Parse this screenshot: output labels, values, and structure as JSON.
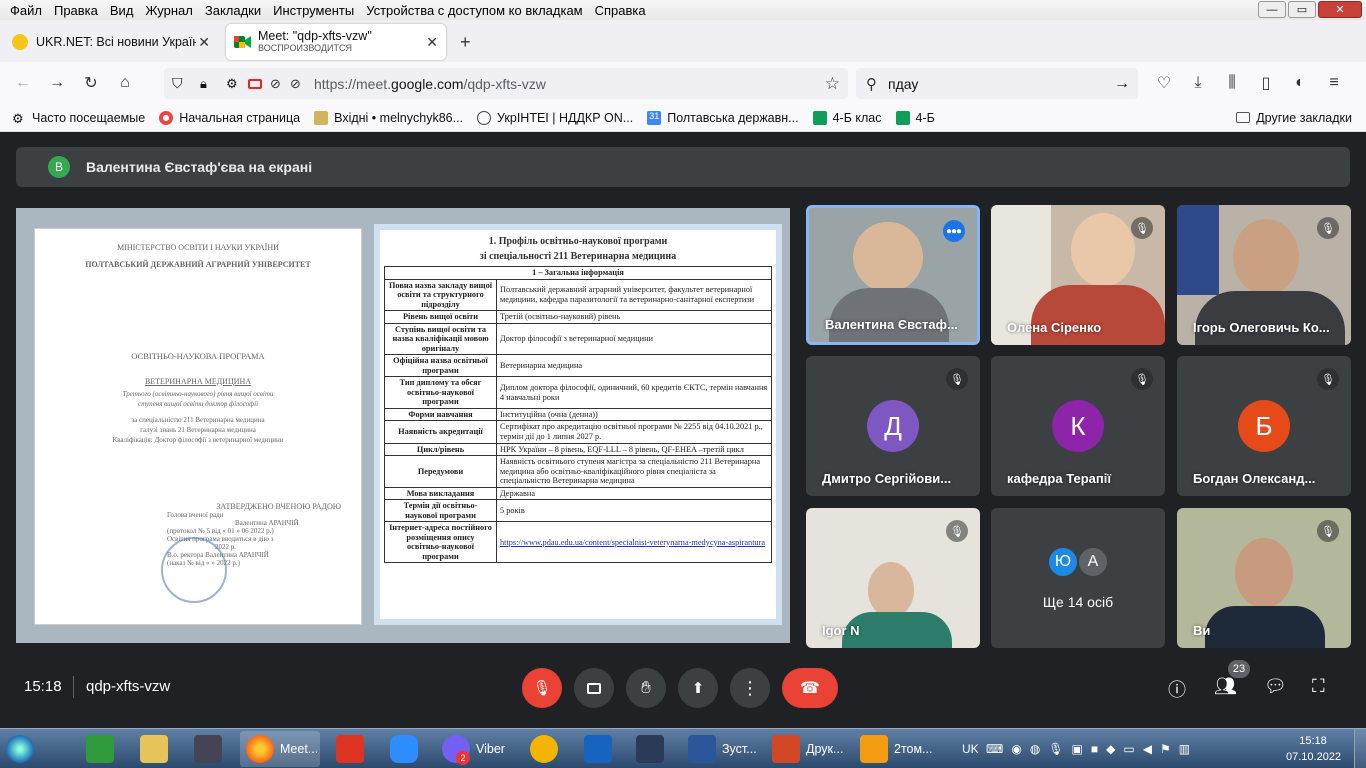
{
  "menu": [
    "Файл",
    "Правка",
    "Вид",
    "Журнал",
    "Закладки",
    "Инструменты",
    "Устройства с доступом ко вкладкам",
    "Справка"
  ],
  "tabs": [
    {
      "title": "UKR.NET: Всі новини України, ос"
    },
    {
      "title": "Meet: \"qdp-xfts-vzw\"",
      "subtitle": "ВОСПРОИЗВОДИТСЯ"
    }
  ],
  "nav": {
    "url_prefix": "https://meet.",
    "url_domain": "google.com",
    "url_path": "/qdp-xfts-vzw",
    "search_value": "пдау"
  },
  "bookmarks": [
    "Часто посещаемые",
    "Начальная страница",
    "Вхідні • melnychyk86...",
    "УкрІНТЕІ | НДДКР ON...",
    "Полтавська державн...",
    "4-Б клас",
    "4-Б"
  ],
  "other_bookmarks": "Другие закладки",
  "banner": {
    "avatar": "В",
    "text": "Валентина Євстаф'єва на екрані"
  },
  "cover": {
    "ministry": "МІНІСТЕРСТВО ОСВІТИ І НАУКИ УКРАЇНИ",
    "university": "ПОЛТАВСЬКИЙ ДЕРЖАВНИЙ АГРАРНИЙ УНІВЕРСИТЕТ",
    "program": "ОСВІТНЬО-НАУКОВА ПРОГРАМА",
    "name": "ВЕТЕРИНАРНА МЕДИЦИНА",
    "line1": "Третього (освітньо-наукового) рівня вищої освіти",
    "line2": "ступеня вищої освіти доктор філософії",
    "line3": "за спеціальністю 211 Ветеринарна медицина",
    "line4": "галузі знань 21 Ветеринарна медицина",
    "line5": "Кваліфікація: Доктор філософії з ветеринарної медицини",
    "approved": "ЗАТВЕРДЖЕНО ВЧЕНОЮ РАДОЮ",
    "sign1": "Голова вченої ради",
    "sign2": "Валентина АРАНЧІЙ",
    "sign3": "(протокол № 5 від « 01 » 06 2022 р.)",
    "sign4": "Освітня програма вводиться в дію з",
    "sign5": "2022 р.",
    "sign6": "В.о. ректора Валентина АРАНЧІЙ",
    "sign7": "(наказ № від « » 2022 р.)"
  },
  "profile": {
    "title1": "1. Профіль освітньо-наукової програми",
    "title2": "зі спеціальності 211 Ветеринарна медицина",
    "section": "1 – Загальна інформація",
    "rows": [
      {
        "k": "Повна назва закладу вищої освіти та структурного підрозділу",
        "v": "Полтавський державний аграрний університет, факультет ветеринарної медицини, кафедра паразитології та ветеринарно-санітарної експертизи"
      },
      {
        "k": "Рівень вищої освіти",
        "v": "Третій (освітньо-науковий) рівень"
      },
      {
        "k": "Ступінь вищої освіти та назва кваліфікації мовою оригіналу",
        "v": "Доктор філософії з ветеринарної медицини"
      },
      {
        "k": "Офіційна назва освітньої програми",
        "v": "Ветеринарна медицина"
      },
      {
        "k": "Тип диплому та обсяг освітньо-наукової програми",
        "v": "Диплом доктора філософії, одиничний, 60 кредитів ЄКТС, термін навчання 4 навчальні роки"
      },
      {
        "k": "Форми навчання",
        "v": "Інституційна (очна (денна))"
      },
      {
        "k": "Наявність акредитації",
        "v": "Сертифікат про акредитацію освітньої програми № 2255 від 04.10.2021 р., термін дії до 1 липня 2027 р."
      },
      {
        "k": "Цикл/рівень",
        "v": "НРК України – 8 рівень, EQF-LLL – 8 рівень, QF-EHEA –третій цикл"
      },
      {
        "k": "Передумови",
        "v": "Наявність освітнього ступеня магістра за спеціальністю 211 Ветеринарна медицина або освітньо-кваліфікаційного рівня спеціаліста за спеціальністю Ветеринарна медицина"
      },
      {
        "k": "Мова викладання",
        "v": "Державна"
      },
      {
        "k": "Термін дії освітньо-наукової програми",
        "v": "5 років"
      },
      {
        "k": "Інтернет-адреса постійного розміщення опису освітньо-наукової програми",
        "v": "https://www.pdau.edu.ua/content/specialnist-veterynarna-medycyna-aspirantura"
      }
    ]
  },
  "participants": [
    {
      "name": "Валентина Євстаф...",
      "speaking": true
    },
    {
      "name": "Олена Сіренко"
    },
    {
      "name": "Ігорь Олеговичь Ко..."
    },
    {
      "name": "Дмитро Сергійови...",
      "initial": "Д",
      "color": "#7e57c2"
    },
    {
      "name": "кафедра Терапії",
      "initial": "К",
      "color": "#8e24aa"
    },
    {
      "name": "Богдан Олександ...",
      "initial": "Б",
      "color": "#e64a19"
    },
    {
      "name": "Igor N"
    },
    {
      "name": "Ви"
    }
  ],
  "others": {
    "a1": "Ю",
    "a2": "А",
    "text": "Ще 14 осіб"
  },
  "meeting": {
    "time": "15:18",
    "code": "qdp-xfts-vzw",
    "people_count": "23"
  },
  "taskbar": {
    "viber": "Viber",
    "viber_badge": "2",
    "meet": "Meet...",
    "word": "Зуст...",
    "ppt": "Друк...",
    "pdf": "2том...",
    "lang": "UK",
    "clock_time": "15:18",
    "clock_date": "07.10.2022"
  }
}
